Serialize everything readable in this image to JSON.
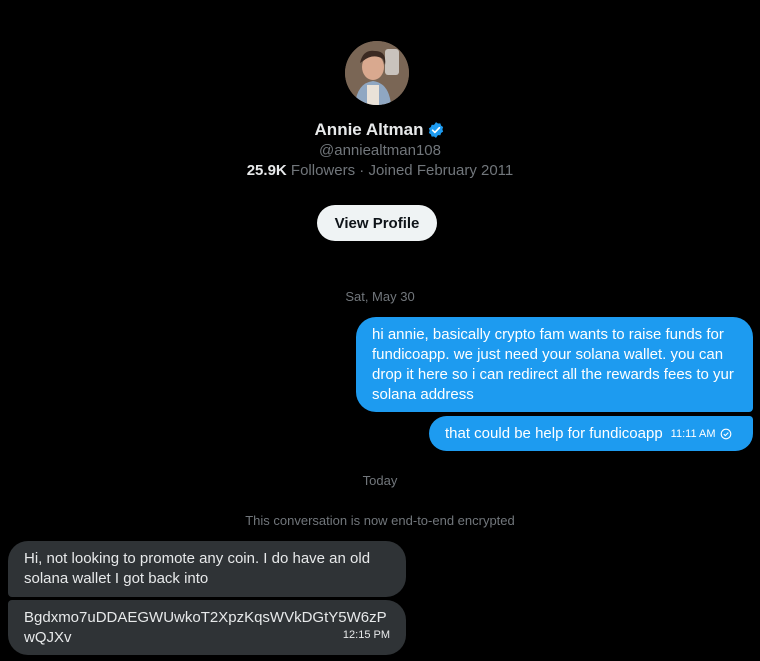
{
  "profile": {
    "name": "Annie Altman",
    "handle": "@anniealtman108",
    "followers_count": "25.9K",
    "followers_label": "Followers",
    "joined": "· Joined February 2011",
    "view_profile_label": "View Profile"
  },
  "conversation": {
    "day1": "Sat, May 30",
    "outgoing_1": "hi annie, basically crypto fam wants to raise funds for fundicoapp. we just need your solana wallet. you can drop it here so i can redirect all the rewards fees to yur solana address",
    "outgoing_2": "that could be help for fundicoapp",
    "outgoing_2_time": "11:11 AM",
    "day2": "Today",
    "encrypted_notice": "This conversation is now end-to-end encrypted",
    "incoming_1": "Hi, not looking to promote any coin. I do have an old solana wallet I got back into",
    "incoming_2": "Bgdxmo7uDDAEGWUwkoT2XpzKqsWVkDGtY5W6zPwQJXv",
    "incoming_2_time": "12:15 PM"
  },
  "colors": {
    "background": "#000000",
    "outgoing_bubble": "#1d9bf0",
    "incoming_bubble": "#2f3336",
    "verified_badge": "#1d9bf0"
  }
}
